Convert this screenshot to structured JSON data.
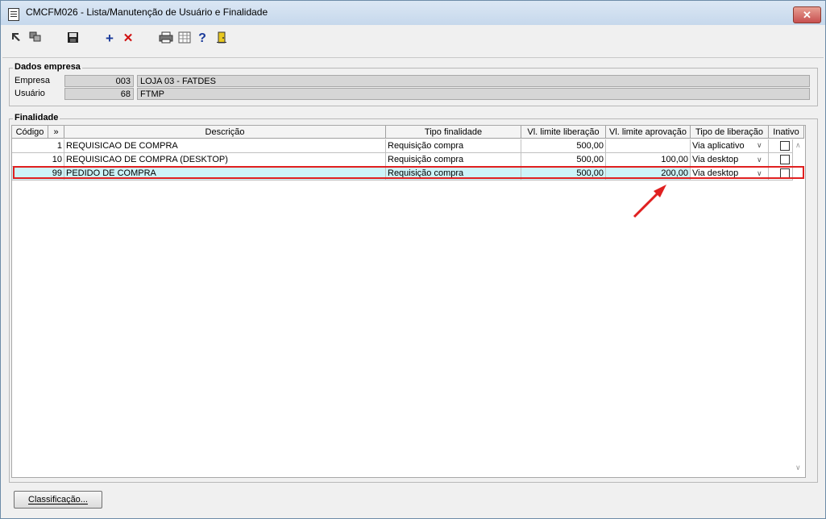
{
  "window": {
    "title": "CMCFM026 - Lista/Manutenção de Usuário e Finalidade"
  },
  "dados_empresa": {
    "legend": "Dados empresa",
    "empresa_label": "Empresa",
    "empresa_code": "003",
    "empresa_name": "LOJA 03 - FATDES",
    "usuario_label": "Usuário",
    "usuario_code": "68",
    "usuario_name": "FTMP"
  },
  "finalidade": {
    "legend": "Finalidade",
    "headers": [
      "Código",
      "»",
      "Descrição",
      "Tipo finalidade",
      "Vl. limite liberação",
      "Vl. limite aprovação",
      "Tipo de liberação",
      "Inativo"
    ],
    "rows": [
      {
        "codigo": "1",
        "descricao": "REQUISICAO DE COMPRA",
        "tipo": "Requisição compra",
        "lib": "500,00",
        "apr": "",
        "tipo_lib": "Via aplicativo",
        "inativo": false
      },
      {
        "codigo": "10",
        "descricao": "REQUISICAO DE COMPRA (DESKTOP)",
        "tipo": "Requisição compra",
        "lib": "500,00",
        "apr": "100,00",
        "tipo_lib": "Via desktop",
        "inativo": false
      },
      {
        "codigo": "99",
        "descricao": "PEDIDO DE COMPRA",
        "tipo": "Requisição compra",
        "lib": "500,00",
        "apr": "200,00",
        "tipo_lib": "Via desktop",
        "inativo": false
      }
    ]
  },
  "buttons": {
    "classificacao": "Classificação..."
  },
  "colors": {
    "highlight": "#e02020",
    "selected_row": "#cdf3f8"
  }
}
